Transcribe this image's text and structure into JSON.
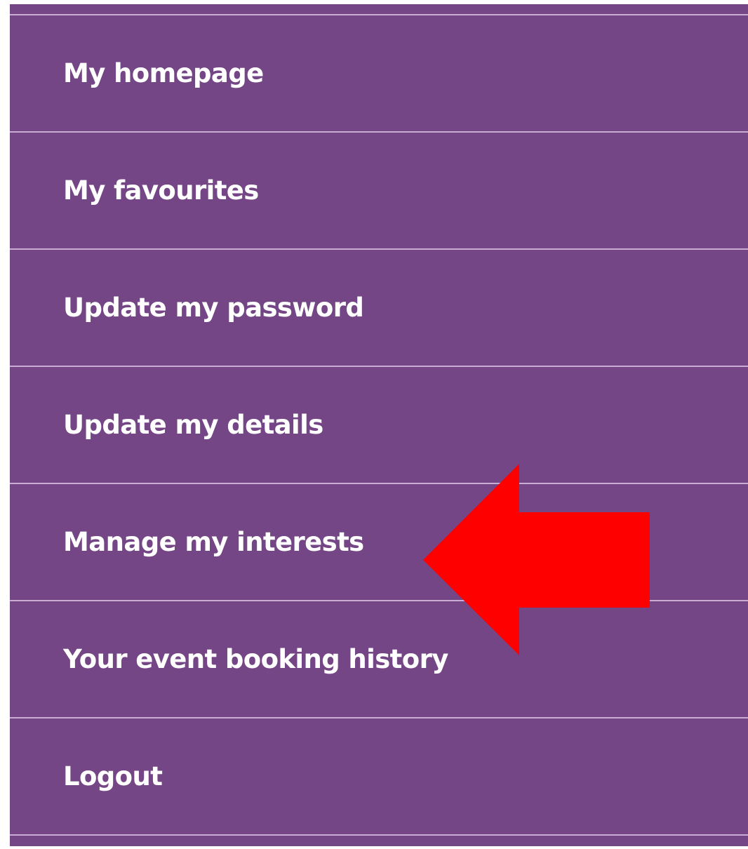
{
  "account_menu": {
    "items": [
      {
        "label": "My homepage"
      },
      {
        "label": "My favourites"
      },
      {
        "label": "Update my password"
      },
      {
        "label": "Update my details"
      },
      {
        "label": "Manage my interests"
      },
      {
        "label": "Your event booking history"
      },
      {
        "label": "Logout"
      }
    ]
  },
  "annotation": {
    "arrow_color": "#ff0000",
    "points_to": "Manage my interests"
  },
  "colors": {
    "menu_background": "#744685",
    "divider": "#c9add3",
    "text": "#ffffff"
  }
}
